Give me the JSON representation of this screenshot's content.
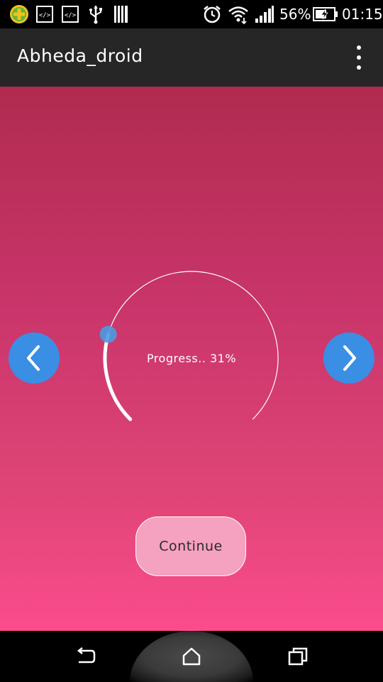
{
  "status_bar": {
    "battery_percent": "56%",
    "time": "01:15",
    "icons": [
      "plus-circle-icon",
      "code-icon",
      "code-icon",
      "usb-icon",
      "barcode-icon",
      "alarm-icon",
      "wifi-icon",
      "signal-icon",
      "battery-charging-icon"
    ]
  },
  "app_bar": {
    "title": "Abheda_droid",
    "menu_icon": "overflow-menu-icon"
  },
  "main": {
    "prev_icon": "chevron-left-icon",
    "next_icon": "chevron-right-icon",
    "progress_text": "Progress.. 31%",
    "progress_value": 0.31,
    "continue_label": "Continue",
    "accent_color": "#3a8ee3",
    "background_top": "#b02b4f",
    "background_bottom": "#fb4c8c"
  },
  "nav_bar": {
    "icons": [
      "back-icon",
      "home-icon",
      "recents-icon"
    ]
  }
}
